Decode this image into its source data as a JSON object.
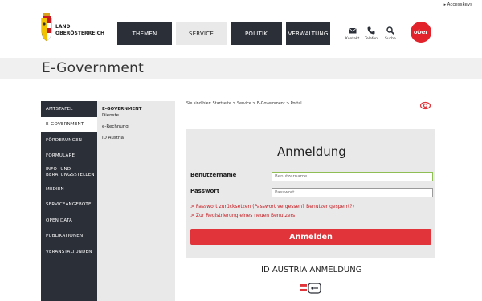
{
  "header": {
    "accesskeys_label": "Accesskeys",
    "logo_line1": "LAND",
    "logo_line2": "OBERÖSTERREICH",
    "nav": [
      "THEMEN",
      "SERVICE",
      "POLITIK",
      "VERWALTUNG"
    ],
    "utilities": [
      "Kontakt",
      "Telefon",
      "Suche"
    ],
    "badge_text": "ober",
    "brand_color": "#e2232c"
  },
  "page": {
    "title": "E-Government"
  },
  "sidebar": {
    "items": [
      "AMTSTAFEL",
      "E-GOVERNMENT",
      "FÖRDERUNGEN",
      "FORMULARE",
      "INFO- UND",
      "BERATUNGSSTELLEN",
      "MEDIEN",
      "SERVICEANGEBOTE",
      "OPEN DATA",
      "PUBLIKATIONEN",
      "VERANSTALTUNDEN"
    ]
  },
  "subnav": {
    "heading": "E-GOVERNMENT",
    "items": [
      "Dienste",
      "e-Rechnung",
      "ID Austria"
    ]
  },
  "breadcrumb": "Sie sind hier: Startseite > Service > E-Government > Portal",
  "login": {
    "title": "Anmeldung",
    "username_label": "Benutzername",
    "username_placeholder": "Benutzername",
    "password_label": "Passwort",
    "password_placeholder": "Passwort",
    "link_reset": "> Passwort zurücksetzen (Passwort vergessen? Benutzer gesperrt?)",
    "link_register": "> Zur Registrierung eines neuen Benutzers",
    "button": "Anmelden",
    "button_color": "#e1343a"
  },
  "id_austria": {
    "title": "ID AUSTRIA ANMELDUNG"
  }
}
